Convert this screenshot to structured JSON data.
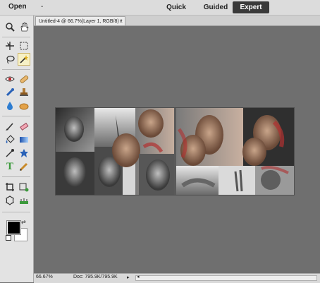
{
  "topbar": {
    "open_label": "Open",
    "dash_label": "-",
    "modes": {
      "quick": "Quick",
      "guided": "Guided",
      "expert": "Expert"
    },
    "active_mode": "Expert"
  },
  "tabs": [
    {
      "label": "Untitled-4 @ 66.7%(Layer 1, RGB/8) *",
      "close": "×"
    }
  ],
  "tools": {
    "zoom": "zoom-icon",
    "hand": "hand-icon",
    "move": "move-icon",
    "marquee": "rect-marquee-icon",
    "lasso": "lasso-icon",
    "magic_wand": "magic-wand-icon",
    "red_eye": "red-eye-icon",
    "spot_heal": "bandage-icon",
    "smart_brush": "smart-brush-icon",
    "clone_stamp": "stamp-icon",
    "blur": "blur-drop-icon",
    "sponge": "sponge-icon",
    "brush": "brush-icon",
    "eraser": "eraser-icon",
    "paint_bucket": "paint-bucket-icon",
    "gradient": "gradient-icon",
    "eyedropper": "eyedropper-icon",
    "custom_shape": "shape-icon",
    "type": "type-icon",
    "pencil": "pencil-icon",
    "crop": "crop-icon",
    "recompose": "recompose-icon",
    "cookie_cutter": "cookie-cutter-icon",
    "straighten": "straighten-icon",
    "selected": "magic_wand"
  },
  "colors": {
    "foreground": "#000000",
    "background": "#ffffff",
    "accent_expert": "#3a3a3a"
  },
  "status": {
    "zoom": "66.67%",
    "doc_size": "Doc: 795.9K/795.9K"
  }
}
